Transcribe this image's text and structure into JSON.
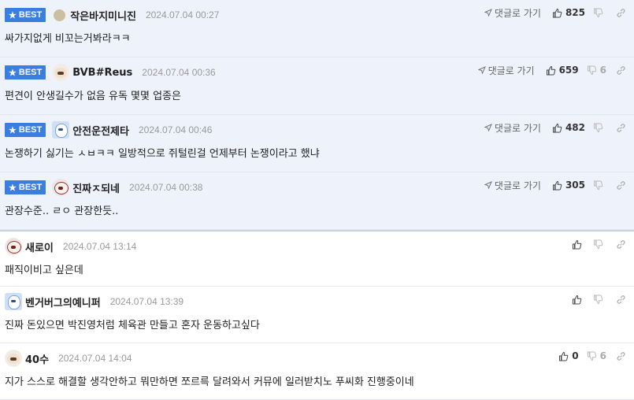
{
  "best_label": "BEST",
  "reply_label": "댓글로 가기",
  "comments": [
    {
      "best": true,
      "nick": "작은바지미니진",
      "date": "2024.07.04 00:27",
      "text": "싸가지없게 비꼬는거봐라ㅋㅋ",
      "up": "825",
      "down": "",
      "avatar": "plain"
    },
    {
      "best": true,
      "nick": "BVB#Reus",
      "date": "2024.07.04 00:36",
      "text": "편견이 안생길수가 없음 유독 몇몇 업종은",
      "up": "659",
      "down": "6",
      "avatar": "dog"
    },
    {
      "best": true,
      "nick": "안전운전제타",
      "date": "2024.07.04 00:46",
      "text": "논쟁하기 싫기는 ㅅㅂㅋㅋ 일방적으로 쥐털린걸 언제부터 논쟁이라고 했냐",
      "up": "482",
      "down": "",
      "avatar": "blue"
    },
    {
      "best": true,
      "nick": "진짜ㅈ되네",
      "date": "2024.07.04 00:38",
      "text": "관장수준.. ㄹㅇ 관장한듯..",
      "up": "305",
      "down": "",
      "avatar": "red"
    },
    {
      "best": false,
      "nick": "새로이",
      "date": "2024.07.04 13:14",
      "text": "패직이비고 싶은데",
      "up": "",
      "down": "",
      "avatar": "red"
    },
    {
      "best": false,
      "nick": "벤거버그의예니퍼",
      "date": "2024.07.04 13:39",
      "text": "진짜 돈있으면 박진영처럼 체육관 만들고 혼자 운동하고싶다",
      "up": "",
      "down": "",
      "avatar": "blue"
    },
    {
      "best": false,
      "nick": "40수",
      "date": "2024.07.04 14:04",
      "text": "지가 스스로 해결할 생각안하고 뭐만하면 쪼르륵 달려와서 커뮤에 일러받치노 푸씨화 진행중이네",
      "up": "0",
      "down": "6",
      "avatar": "dog"
    }
  ]
}
